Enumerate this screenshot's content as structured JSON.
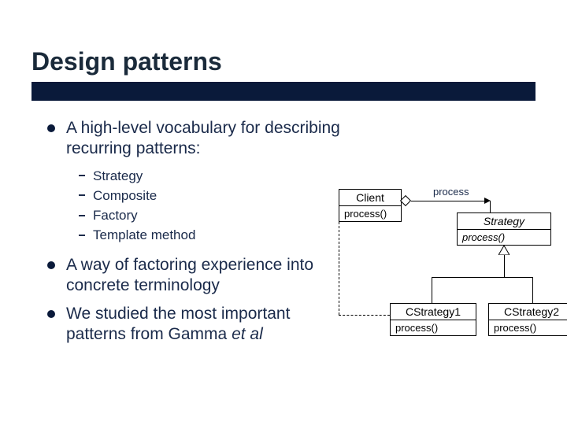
{
  "title": "Design patterns",
  "bullets": {
    "b1": "A high-level vocabulary for describing recurring patterns:",
    "subs": {
      "s1": "Strategy",
      "s2": "Composite",
      "s3": "Factory",
      "s4": "Template method"
    },
    "b2": "A way of factoring experience into concrete terminology",
    "b3_a": "We studied the most important patterns from Gamma ",
    "b3_b": "et al"
  },
  "dia": {
    "client": {
      "name": "Client",
      "method": "process()"
    },
    "assoc_label": "process",
    "strategy": {
      "name": "Strategy",
      "method": "process()"
    },
    "cs1": {
      "name": "CStrategy1",
      "method": "process()"
    },
    "cs2": {
      "name": "CStrategy2",
      "method": "process()"
    }
  }
}
